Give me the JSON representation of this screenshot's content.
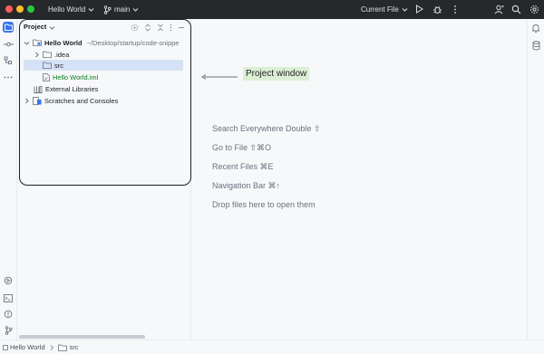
{
  "titlebar": {
    "project_name": "Hello World",
    "branch": "main",
    "run_config": "Current File"
  },
  "project_panel": {
    "title": "Project",
    "tree": [
      {
        "label": "Hello World",
        "path": "~/Desktop/startup/code-snippe",
        "type": "module",
        "expanded": true
      },
      {
        "label": ".idea",
        "type": "folder",
        "expanded": false
      },
      {
        "label": "src",
        "type": "folder",
        "selected": true
      },
      {
        "label": "Hello World.iml",
        "type": "iml-file"
      },
      {
        "label": "External Libraries",
        "type": "libraries"
      },
      {
        "label": "Scratches and Consoles",
        "type": "scratches",
        "expanded": false
      }
    ]
  },
  "callout": {
    "label": "Project window"
  },
  "hints": [
    "Search Everywhere Double ⇧",
    "Go to File ⇧⌘O",
    "Recent Files ⌘E",
    "Navigation Bar ⌘↑",
    "Drop files here to open them"
  ],
  "statusbar": {
    "crumb_project": "Hello World",
    "crumb_folder": "src"
  },
  "colors": {
    "titlebar_bg": "#27282c",
    "selection": "#d5e1f6",
    "callout_bg": "#dcefd5",
    "iml_text": "#067d17",
    "accent": "#3574f0"
  }
}
